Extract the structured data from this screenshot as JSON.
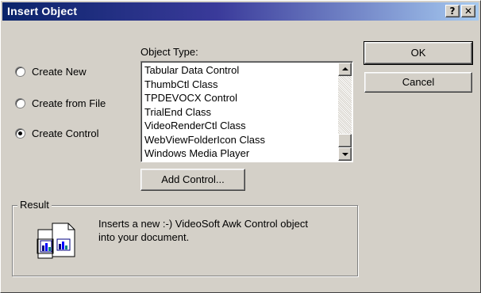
{
  "window": {
    "title": "Insert Object",
    "help_label": "?",
    "close_label": "✕"
  },
  "options": [
    {
      "label": "Create New",
      "checked": false
    },
    {
      "label": "Create from File",
      "checked": false
    },
    {
      "label": "Create Control",
      "checked": true
    }
  ],
  "object_type": {
    "label": "Object Type:",
    "items": [
      "Tabular Data Control",
      "ThumbCtl Class",
      "TPDEVOCX Control",
      "TrialEnd Class",
      "VideoRenderCtl Class",
      "WebViewFolderIcon Class",
      "Windows Media Player"
    ]
  },
  "buttons": {
    "ok": "OK",
    "cancel": "Cancel",
    "add_control": "Add Control..."
  },
  "result": {
    "legend": "Result",
    "line1": "Inserts a new :-) VideoSoft Awk Control object",
    "line2": "into your document."
  },
  "icons": {
    "result_icon": "ole-object-icon"
  }
}
